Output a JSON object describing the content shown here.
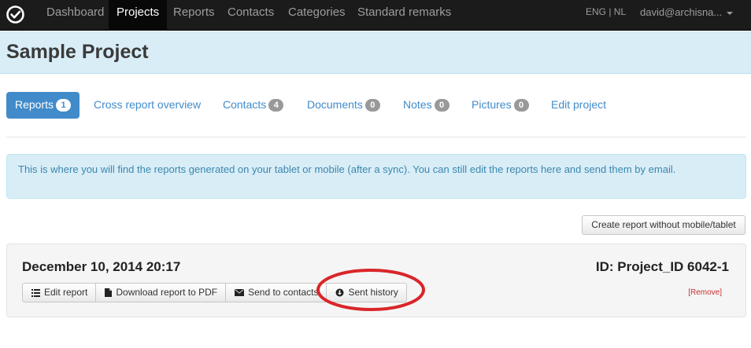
{
  "navbar": {
    "logo_icon": "check-circle-icon",
    "items": [
      "Dashboard",
      "Projects",
      "Reports",
      "Contacts",
      "Categories",
      "Standard remarks"
    ],
    "active_item": "Projects",
    "language": "ENG | NL",
    "user": "david@archisna..."
  },
  "header": {
    "title": "Sample Project"
  },
  "tabs": [
    {
      "label": "Reports",
      "badge": "1",
      "active": true
    },
    {
      "label": "Cross report overview"
    },
    {
      "label": "Contacts",
      "badge": "4"
    },
    {
      "label": "Documents",
      "badge": "0"
    },
    {
      "label": "Notes",
      "badge": "0"
    },
    {
      "label": "Pictures",
      "badge": "0"
    },
    {
      "label": "Edit project"
    }
  ],
  "alert": {
    "text": "This is where you will find the reports generated on your tablet or mobile (after a sync). You can still edit the reports here and send them by email."
  },
  "actions": {
    "create_label": "Create report without mobile/tablet"
  },
  "report": {
    "date": "December 10, 2014 20:17",
    "id_label": "ID: Project_ID 6042-1",
    "buttons": [
      {
        "label": "Edit report",
        "icon": "list-icon"
      },
      {
        "label": "Download report to PDF",
        "icon": "file-icon"
      },
      {
        "label": "Send to contacts",
        "icon": "envelope-icon"
      },
      {
        "label": "Sent history",
        "icon": "info-circle-icon"
      }
    ],
    "remove_label": "[Remove]"
  },
  "colors": {
    "navbar_bg": "#1b1b1b",
    "header_bg": "#d9edf7",
    "primary": "#428bca",
    "alert_text": "#3a87ad",
    "highlight": "#d9262a"
  }
}
